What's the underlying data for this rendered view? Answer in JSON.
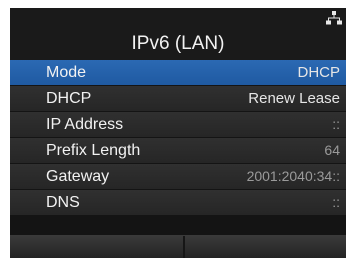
{
  "header": {
    "title": "IPv6 (LAN)",
    "status_icon": "network-icon"
  },
  "menu": {
    "rows": [
      {
        "label": "Mode",
        "value": "DHCP",
        "selected": true
      },
      {
        "label": "DHCP",
        "value": "Renew Lease",
        "selected": false
      },
      {
        "label": "IP Address",
        "value": "::",
        "selected": false
      },
      {
        "label": "Prefix Length",
        "value": "64",
        "selected": false
      },
      {
        "label": "Gateway",
        "value": "2001:2040:34::",
        "selected": false
      },
      {
        "label": "DNS",
        "value": "::",
        "selected": false
      }
    ]
  },
  "footer": {
    "softkeys": [
      "",
      ""
    ]
  },
  "colors": {
    "selected_row": "#2563AB",
    "row": "#2C2C2C",
    "background": "#141414"
  }
}
